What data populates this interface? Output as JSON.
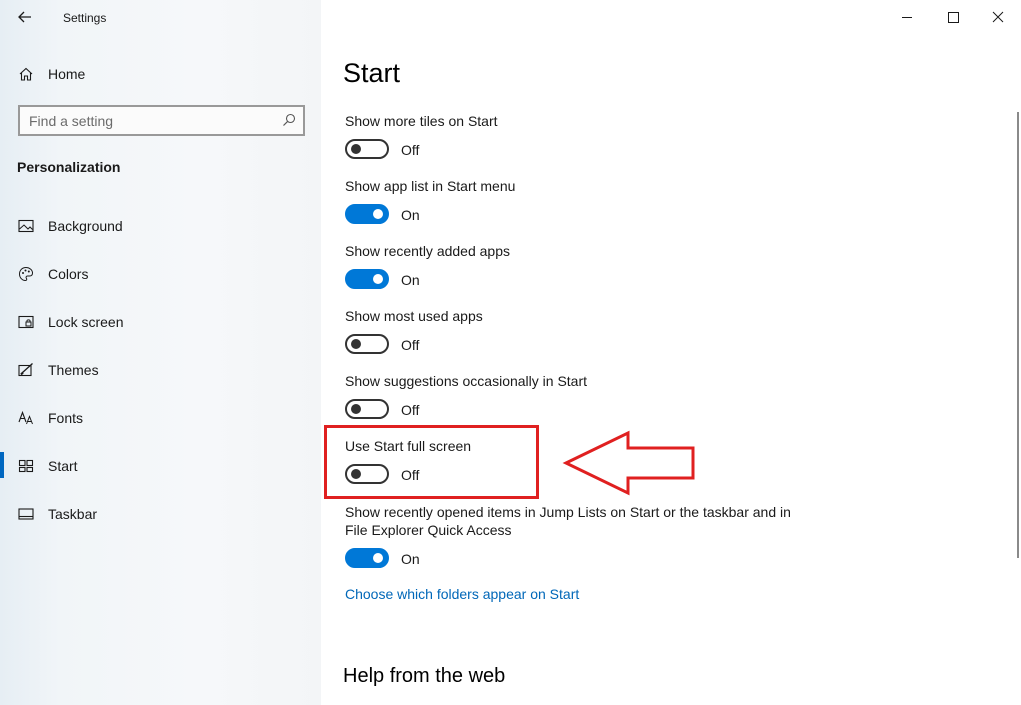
{
  "window": {
    "title": "Settings",
    "controls": {
      "minimize_icon": "minimize-icon",
      "maximize_icon": "maximize-icon",
      "close_icon": "close-icon"
    }
  },
  "sidebar": {
    "home_label": "Home",
    "search_placeholder": "Find a setting",
    "section_heading": "Personalization",
    "items": [
      {
        "label": "Background",
        "icon": "picture-icon"
      },
      {
        "label": "Colors",
        "icon": "palette-icon"
      },
      {
        "label": "Lock screen",
        "icon": "lock-screen-icon"
      },
      {
        "label": "Themes",
        "icon": "themes-icon"
      },
      {
        "label": "Fonts",
        "icon": "fonts-icon"
      },
      {
        "label": "Start",
        "icon": "start-icon",
        "selected": true
      },
      {
        "label": "Taskbar",
        "icon": "taskbar-icon"
      }
    ]
  },
  "main": {
    "title": "Start",
    "settings": [
      {
        "label": "Show more tiles on Start",
        "state": "Off",
        "on": false
      },
      {
        "label": "Show app list in Start menu",
        "state": "On",
        "on": true
      },
      {
        "label": "Show recently added apps",
        "state": "On",
        "on": true
      },
      {
        "label": "Show most used apps",
        "state": "Off",
        "on": false
      },
      {
        "label": "Show suggestions occasionally in Start",
        "state": "Off",
        "on": false
      },
      {
        "label": "Use Start full screen",
        "state": "Off",
        "on": false
      },
      {
        "label": "Show recently opened items in Jump Lists on Start or the taskbar and in File Explorer Quick Access",
        "state": "On",
        "on": true
      }
    ],
    "folders_link": "Choose which folders appear on Start",
    "help_heading": "Help from the web"
  },
  "colors": {
    "accent": "#0078d7",
    "annotation": "#e02020"
  }
}
